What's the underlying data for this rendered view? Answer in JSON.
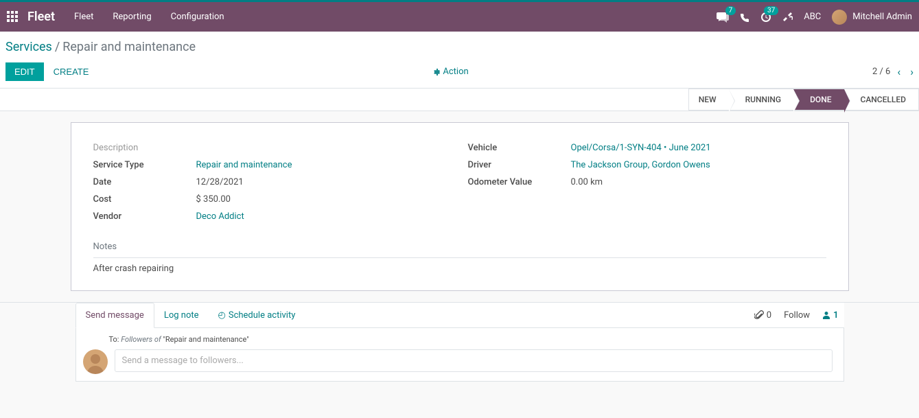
{
  "topbar": {
    "app_name": "Fleet",
    "menu": [
      "Fleet",
      "Reporting",
      "Configuration"
    ],
    "chat_badge": "7",
    "activity_badge": "37",
    "abc": "ABC",
    "user_name": "Mitchell Admin"
  },
  "breadcrumb": {
    "parent": "Services",
    "current": "Repair and maintenance"
  },
  "toolbar": {
    "edit": "EDIT",
    "create": "CREATE",
    "action": "Action",
    "pager": "2 / 6"
  },
  "statusbar": {
    "new": "NEW",
    "running": "RUNNING",
    "done": "DONE",
    "cancelled": "CANCELLED"
  },
  "form": {
    "left": {
      "description_label": "Description",
      "description_value": "",
      "service_type_label": "Service Type",
      "service_type_value": "Repair and maintenance",
      "date_label": "Date",
      "date_value": "12/28/2021",
      "cost_label": "Cost",
      "cost_value": "$ 350.00",
      "vendor_label": "Vendor",
      "vendor_value": "Deco Addict"
    },
    "right": {
      "vehicle_label": "Vehicle",
      "vehicle_value": "Opel/Corsa/1-SYN-404 • June 2021",
      "driver_label": "Driver",
      "driver_value": "The Jackson Group, Gordon Owens",
      "odometer_label": "Odometer Value",
      "odometer_value": "0.00  km"
    },
    "notes_label": "Notes",
    "notes_body": "After crash repairing"
  },
  "chatter": {
    "tab_send": "Send message",
    "tab_log": "Log note",
    "tab_activity": "Schedule activity",
    "attach_count": "0",
    "follow": "Follow",
    "followers_count": "1",
    "to_label": "To:",
    "to_followers": "Followers of ",
    "to_doc": "\"Repair and maintenance\"",
    "placeholder": "Send a message to followers..."
  }
}
